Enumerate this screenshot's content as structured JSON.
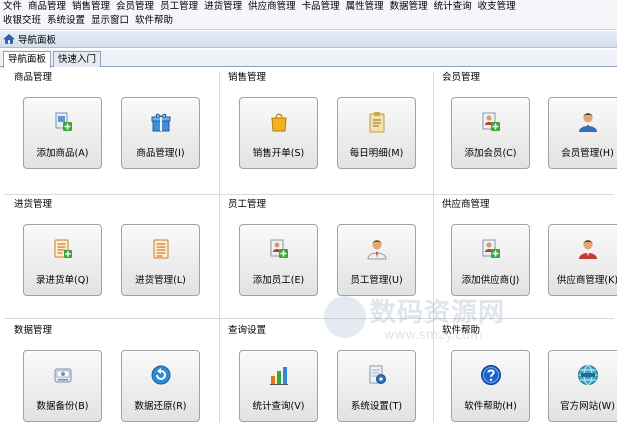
{
  "menubar": {
    "row1": [
      "文件",
      "商品管理",
      "销售管理",
      "会员管理",
      "员工管理",
      "进货管理",
      "供应商管理",
      "卡品管理",
      "属性管理",
      "数据管理",
      "统计查询",
      "收支管理"
    ],
    "row2": [
      "收银交班",
      "系统设置",
      "显示窗口",
      "软件帮助"
    ]
  },
  "panel": {
    "title": "导航面板"
  },
  "tabs": [
    "导航面板",
    "快速入门"
  ],
  "sections": {
    "goods": "商品管理",
    "sales": "销售管理",
    "members": "会员管理",
    "purchase": "进货管理",
    "staff": "员工管理",
    "supplier": "供应商管理",
    "data": "数据管理",
    "query": "查询设置",
    "help": "软件帮助"
  },
  "tiles": {
    "add_goods": "添加商品(A)",
    "goods_manage": "商品管理(I)",
    "sales_open": "销售开单(S)",
    "daily_detail": "每日明细(M)",
    "add_member": "添加会员(C)",
    "member_manage": "会员管理(H)",
    "purchase_entry": "录进货单(Q)",
    "purchase_manage": "进货管理(L)",
    "add_staff": "添加员工(E)",
    "staff_manage": "员工管理(U)",
    "add_supplier": "添加供应商(J)",
    "supplier_manage": "供应商管理(K)",
    "data_backup": "数据备份(B)",
    "data_restore": "数据还原(R)",
    "stat_query": "统计查询(V)",
    "system_settings": "系统设置(T)",
    "software_help": "软件帮助(H)",
    "official_site": "官方网站(W)"
  },
  "watermark": {
    "big": "数码资源网",
    "small": "www.smzy.com"
  },
  "colors": {
    "menubar_bg": "#f4f6f9",
    "tile_border": "#9aa3ae",
    "divider": "#d6dbe3",
    "accent_blue": "#1e5aa8"
  }
}
